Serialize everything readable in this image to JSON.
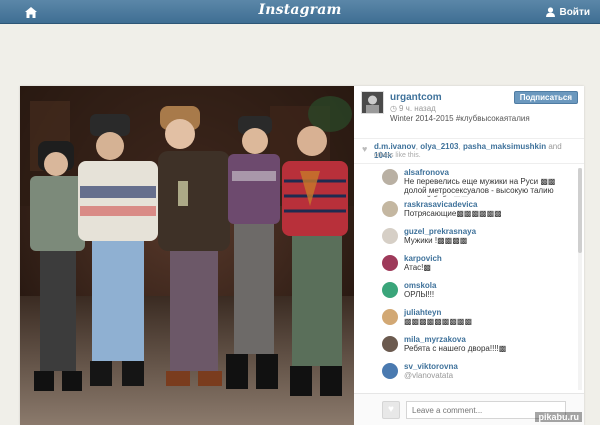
{
  "topbar": {
    "logo": "Instagram",
    "login_label": "Войти",
    "icons": {
      "home": "home-icon",
      "user": "user-icon"
    }
  },
  "post": {
    "username": "urgantcom",
    "time": "9 ч. назад",
    "caption": "Winter 2014-2015 #клубвысокаяталия",
    "follow_label": "Подписаться",
    "photo": "group-photo-five-men-in-retro-winter-outfits",
    "likes_names": [
      "d.m.ivanov",
      "olya_2103",
      "pasha_maksimushkin"
    ],
    "likes_and": "and",
    "likes_count": "104k",
    "likes_suffix": "others like this.",
    "comment_placeholder": "Leave a comment...",
    "watermark": "pikabu.ru"
  },
  "comments": [
    {
      "user": "alsafronova",
      "text": "Не перевелись еще мужики на Руси ▩▩ долой метросексуалов - высокую талию каждой бабе ▩▩",
      "avatar_color": "#b9b0a3"
    },
    {
      "user": "raskrasavicadevica",
      "text": "Потрясающие▩▩▩▩▩▩",
      "avatar_color": "#c4b7a1"
    },
    {
      "user": "guzel_prekrasnaya",
      "text": "Мужики !▩▩▩▩",
      "avatar_color": "#d6cfc6"
    },
    {
      "user": "karpovich",
      "text": "Атас!▩",
      "avatar_color": "#9e3a5a"
    },
    {
      "user": "omskola",
      "text": "ОРЛЫ!!!",
      "avatar_color": "#3aa57a"
    },
    {
      "user": "juliahteyn",
      "text": "▩▩▩▩▩▩▩▩▩",
      "avatar_color": "#d2a874"
    },
    {
      "user": "mila_myrzakova",
      "text": "Ребята с нашего двора!!!!▩",
      "avatar_color": "#6b5a4f"
    },
    {
      "user": "sv_viktorovna",
      "text": "@vlanovatata",
      "avatar_color": "#4a7ab0"
    }
  ],
  "colors": {
    "topbar": "#4a7aa0",
    "link": "#3f729b",
    "button": "#6b98be",
    "background": "#f0efe9"
  }
}
